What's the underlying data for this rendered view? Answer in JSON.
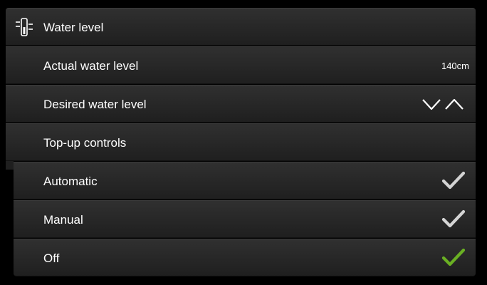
{
  "panel": {
    "title": "Water level",
    "actual": {
      "label": "Actual water level",
      "value": "140cm"
    },
    "desired": {
      "label": "Desired water level",
      "down_icon": "chevron-down-icon",
      "up_icon": "chevron-up-icon"
    },
    "topup": {
      "label": "Top-up controls",
      "options": [
        {
          "label": "Automatic",
          "selected": false
        },
        {
          "label": "Manual",
          "selected": false
        },
        {
          "label": "Off",
          "selected": true
        }
      ]
    }
  },
  "colors": {
    "check_inactive": "#d4d4d4",
    "check_active": "#6ab023"
  }
}
